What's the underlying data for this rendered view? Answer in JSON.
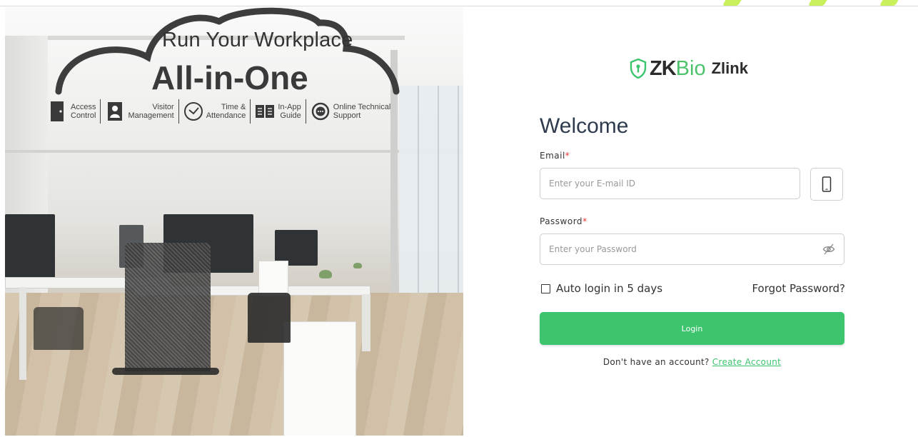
{
  "hero": {
    "headline_line1": "Run Your Workplace",
    "headline_line2": "All-in-One",
    "features": [
      {
        "icon": "door-icon",
        "label": "Access\nControl"
      },
      {
        "icon": "visitor-badge-icon",
        "label": "Visitor\nManagement"
      },
      {
        "icon": "clock-icon",
        "label": "Time &\nAttendance"
      },
      {
        "icon": "book-icon",
        "label": "In-App\nGuide"
      },
      {
        "icon": "support-chat-icon",
        "label": "Online Technical\nSupport"
      }
    ]
  },
  "brand": {
    "logo_icon": "shield-icon",
    "name_part1": "ZK",
    "name_part2": "Bio",
    "product": "Zlink",
    "accent_color": "#3cc46e"
  },
  "form": {
    "title": "Welcome",
    "email_label": "Email",
    "email_placeholder": "Enter your E-mail ID",
    "phone_toggle_icon": "mobile-phone-icon",
    "password_label": "Password",
    "password_placeholder": "Enter your Password",
    "password_toggle_icon": "eye-slash-icon",
    "required_mark": "*",
    "auto_login_label": "Auto login in 5 days",
    "forgot_password": "Forgot Password?",
    "login_button": "Login",
    "signup_prompt": "Don't have an account?",
    "signup_link": "Create Account"
  }
}
